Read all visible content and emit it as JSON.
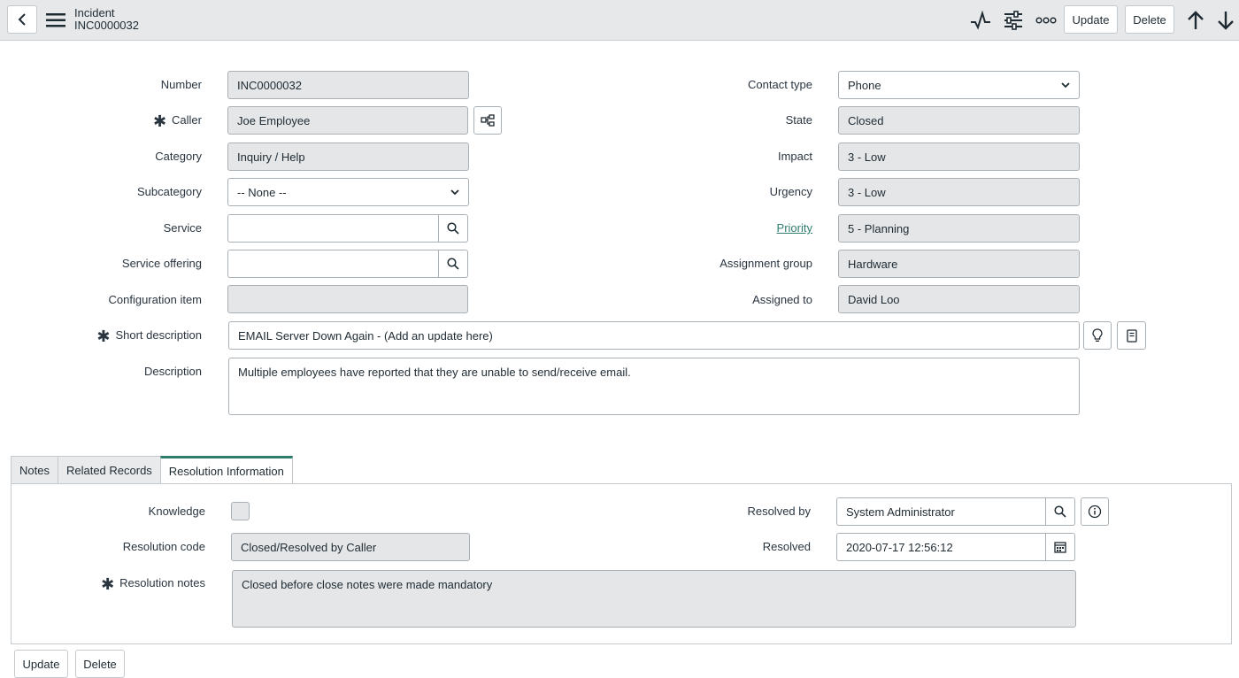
{
  "header": {
    "title": "Incident",
    "subtitle": "INC0000032",
    "update_label": "Update",
    "delete_label": "Delete"
  },
  "form": {
    "number": {
      "label": "Number",
      "value": "INC0000032"
    },
    "caller": {
      "label": "Caller",
      "value": "Joe Employee"
    },
    "category": {
      "label": "Category",
      "value": "Inquiry / Help"
    },
    "subcategory": {
      "label": "Subcategory",
      "value": "-- None --"
    },
    "service": {
      "label": "Service",
      "value": ""
    },
    "service_offering": {
      "label": "Service offering",
      "value": ""
    },
    "configuration_item": {
      "label": "Configuration item",
      "value": ""
    },
    "contact_type": {
      "label": "Contact type",
      "value": "Phone"
    },
    "state": {
      "label": "State",
      "value": "Closed"
    },
    "impact": {
      "label": "Impact",
      "value": "3 - Low"
    },
    "urgency": {
      "label": "Urgency",
      "value": "3 - Low"
    },
    "priority": {
      "label": "Priority",
      "value": "5 - Planning"
    },
    "assignment_group": {
      "label": "Assignment group",
      "value": "Hardware"
    },
    "assigned_to": {
      "label": "Assigned to",
      "value": "David Loo"
    },
    "short_description": {
      "label": "Short description",
      "value": "EMAIL Server Down Again - (Add an update here)"
    },
    "description": {
      "label": "Description",
      "value": "Multiple employees have reported that they are unable to send/receive email."
    }
  },
  "tabs": [
    {
      "label": "Notes"
    },
    {
      "label": "Related Records"
    },
    {
      "label": "Resolution Information"
    }
  ],
  "resolution": {
    "knowledge": {
      "label": "Knowledge",
      "checked": false
    },
    "resolution_code": {
      "label": "Resolution code",
      "value": "Closed/Resolved by Caller"
    },
    "resolution_notes": {
      "label": "Resolution notes",
      "value": "Closed before close notes were made mandatory"
    },
    "resolved_by": {
      "label": "Resolved by",
      "value": "System Administrator"
    },
    "resolved": {
      "label": "Resolved",
      "value": "2020-07-17 12:56:12"
    }
  },
  "footer": {
    "update_label": "Update",
    "delete_label": "Delete"
  }
}
